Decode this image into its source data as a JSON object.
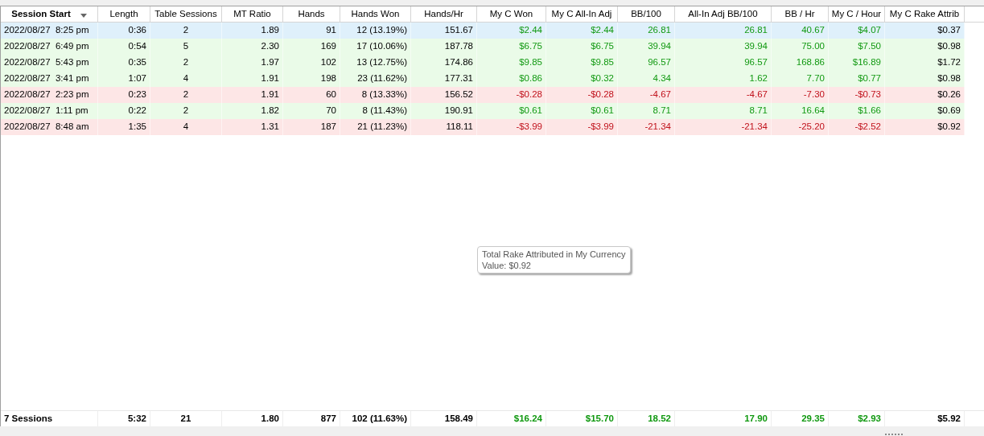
{
  "columns": [
    {
      "label": "Session Start",
      "kind": "date",
      "sorted": true
    },
    {
      "label": "Length",
      "kind": "number",
      "sorted": false
    },
    {
      "label": "Table Sessions",
      "kind": "count",
      "sorted": false
    },
    {
      "label": "MT Ratio",
      "kind": "number",
      "sorted": false
    },
    {
      "label": "Hands",
      "kind": "number",
      "sorted": false
    },
    {
      "label": "Hands Won",
      "kind": "number",
      "sorted": false
    },
    {
      "label": "Hands/Hr",
      "kind": "number",
      "sorted": false
    },
    {
      "label": "My C Won",
      "kind": "money",
      "sorted": false
    },
    {
      "label": "My C All-In Adj",
      "kind": "money",
      "sorted": false
    },
    {
      "label": "BB/100",
      "kind": "money",
      "sorted": false
    },
    {
      "label": "All-In Adj BB/100",
      "kind": "money",
      "sorted": false
    },
    {
      "label": "BB / Hr",
      "kind": "money",
      "sorted": false
    },
    {
      "label": "My C / Hour",
      "kind": "money",
      "sorted": false
    },
    {
      "label": "My C Rake Attrib",
      "kind": "number",
      "sorted": false
    }
  ],
  "rows": [
    {
      "selected": true,
      "winning": true,
      "cells": [
        "2022/08/27  8:25 pm",
        "0:36",
        "2",
        "1.89",
        "91",
        "12 (13.19%)",
        "151.67",
        "$2.44",
        "$2.44",
        "26.81",
        "26.81",
        "40.67",
        "$4.07",
        "$0.37"
      ]
    },
    {
      "selected": false,
      "winning": true,
      "cells": [
        "2022/08/27  6:49 pm",
        "0:54",
        "5",
        "2.30",
        "169",
        "17 (10.06%)",
        "187.78",
        "$6.75",
        "$6.75",
        "39.94",
        "39.94",
        "75.00",
        "$7.50",
        "$0.98"
      ]
    },
    {
      "selected": false,
      "winning": true,
      "cells": [
        "2022/08/27  5:43 pm",
        "0:35",
        "2",
        "1.97",
        "102",
        "13 (12.75%)",
        "174.86",
        "$9.85",
        "$9.85",
        "96.57",
        "96.57",
        "168.86",
        "$16.89",
        "$1.72"
      ]
    },
    {
      "selected": false,
      "winning": true,
      "cells": [
        "2022/08/27  3:41 pm",
        "1:07",
        "4",
        "1.91",
        "198",
        "23 (11.62%)",
        "177.31",
        "$0.86",
        "$0.32",
        "4.34",
        "1.62",
        "7.70",
        "$0.77",
        "$0.98"
      ]
    },
    {
      "selected": false,
      "winning": false,
      "cells": [
        "2022/08/27  2:23 pm",
        "0:23",
        "2",
        "1.91",
        "60",
        "8 (13.33%)",
        "156.52",
        "-$0.28",
        "-$0.28",
        "-4.67",
        "-4.67",
        "-7.30",
        "-$0.73",
        "$0.26"
      ]
    },
    {
      "selected": false,
      "winning": true,
      "cells": [
        "2022/08/27  1:11 pm",
        "0:22",
        "2",
        "1.82",
        "70",
        "8 (11.43%)",
        "190.91",
        "$0.61",
        "$0.61",
        "8.71",
        "8.71",
        "16.64",
        "$1.66",
        "$0.69"
      ]
    },
    {
      "selected": false,
      "winning": false,
      "cells": [
        "2022/08/27  8:48 am",
        "1:35",
        "4",
        "1.31",
        "187",
        "21 (11.23%)",
        "118.11",
        "-$3.99",
        "-$3.99",
        "-21.34",
        "-21.34",
        "-25.20",
        "-$2.52",
        "$0.92"
      ]
    }
  ],
  "totals": {
    "winning": true,
    "cells": [
      "7 Sessions",
      "5:32",
      "21",
      "1.80",
      "877",
      "102 (11.63%)",
      "158.49",
      "$16.24",
      "$15.70",
      "18.52",
      "17.90",
      "29.35",
      "$2.93",
      "$5.92"
    ]
  },
  "tooltip": {
    "title": "Total Rake Attributed in My Currency",
    "value": "Value: $0.92"
  }
}
